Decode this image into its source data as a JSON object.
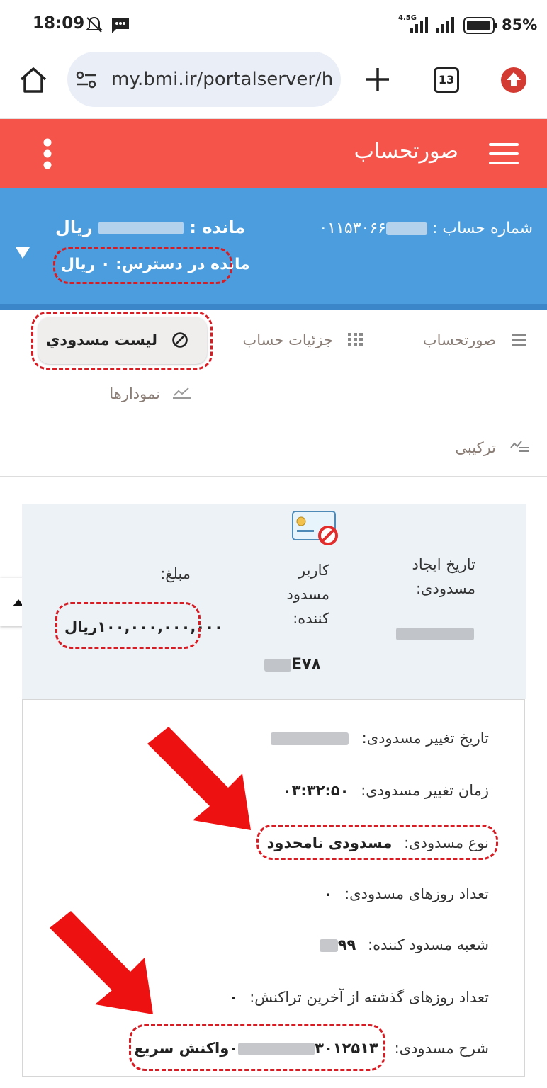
{
  "status_bar": {
    "time": "18:09",
    "network": "4.5G",
    "battery": "85%"
  },
  "browser": {
    "url": "my.bmi.ir/portalserver/h",
    "tab_count": "13"
  },
  "app_bar": {
    "title": "صورتحساب"
  },
  "account": {
    "number_label": "شماره حساب :",
    "number_visible": "۰۱۱۵۳۰۶۶",
    "balance_label": "مانده :",
    "balance_unit": "ریال",
    "available_label": "مانده در دسترس:",
    "available_value": "۰",
    "available_unit": "ریال"
  },
  "tabs": {
    "statement": "صورتحساب",
    "details": "جزئیات حساب",
    "blocked_list": "لیست مسدودي",
    "charts": "نمودارها",
    "combined": "ترکیبی"
  },
  "summary": {
    "created_date_label": "تاریخ ایجاد مسدودی:",
    "blocker_label": "کاربر مسدود کننده:",
    "blocker_value_prefix": "E۷۸",
    "amount_label": "مبلغ:",
    "amount_value": "۱۰۰,۰۰۰,۰۰۰,۰۰۰ریال"
  },
  "details": {
    "change_date_label": "تاریخ تغییر مسدودی:",
    "change_time_label": "زمان تغییر مسدودی:",
    "change_time_value": "۰۳:۳۲:۵۰",
    "type_label": "نوع مسدودی:",
    "type_value": "مسدودی نامحدود",
    "days_label": "تعداد روزهای مسدودی:",
    "days_value": "۰",
    "branch_label": "شعبه مسدود کننده:",
    "branch_value_prefix": "۹۹",
    "last_txn_label": "تعداد روزهای گذشته از آخرین تراکنش:",
    "last_txn_value": "۰",
    "desc_label": "شرح مسدودی:",
    "desc_prefix": "۳۰۱۲۵۱۳",
    "desc_suffix": "۰واکنش سریع"
  },
  "colors": {
    "app_bar": "#f4544a",
    "account_band": "#4b9ddd",
    "highlight": "#d81c24"
  }
}
